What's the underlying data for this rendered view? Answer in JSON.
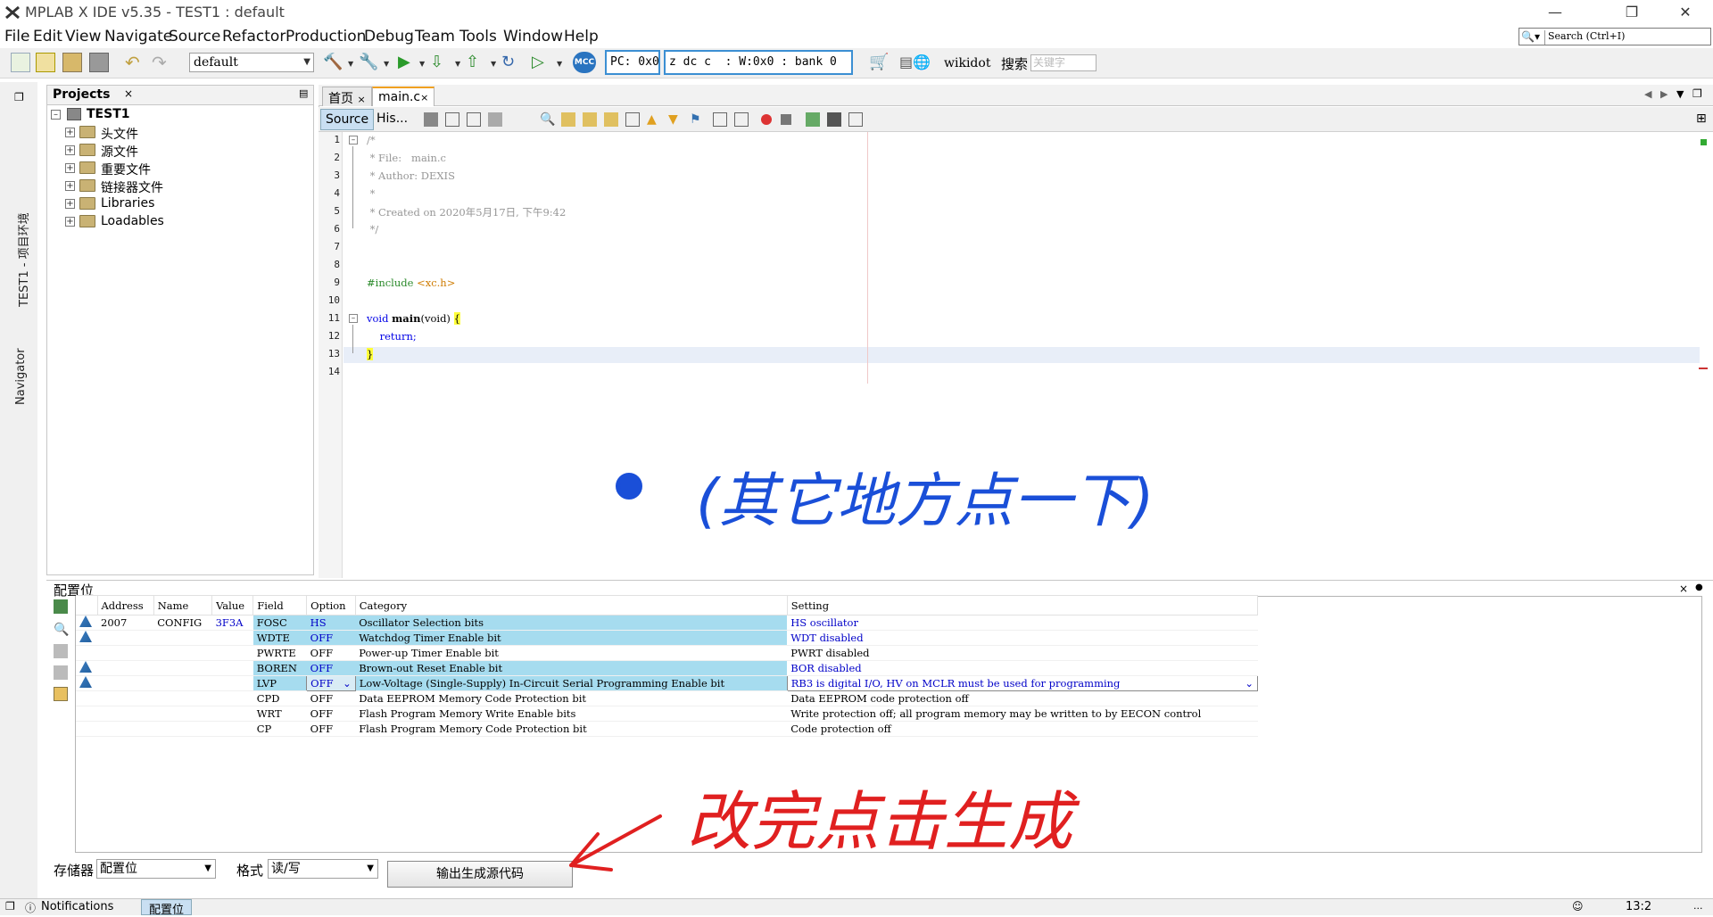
{
  "window": {
    "title": "MPLAB X IDE v5.35 - TEST1 : default",
    "controls": [
      "minimize-icon",
      "restore-icon",
      "close-icon"
    ]
  },
  "menu": [
    "File",
    "Edit",
    "View",
    "Navigate",
    "Source",
    "Refactor",
    "Production",
    "Debug",
    "Team",
    "Tools",
    "Window",
    "Help"
  ],
  "search": {
    "placeholder": "Search (Ctrl+I)"
  },
  "toolbar": {
    "config": "default",
    "pc": "PC: 0x0",
    "status_bits": "z dc c  : W:0x0 : bank 0",
    "wiki": "wikidot",
    "search_cn": "搜索",
    "keyword_placeholder": "关键字"
  },
  "left_strip": {
    "projects_env": "TEST1 - 项目环境",
    "navigator": "Navigator"
  },
  "projects": {
    "title": "Projects",
    "root": "TEST1",
    "items": [
      "头文件",
      "源文件",
      "重要文件",
      "链接器文件",
      "Libraries",
      "Loadables"
    ]
  },
  "editor": {
    "tabs": [
      {
        "label": "首页"
      },
      {
        "label": "main.c"
      }
    ],
    "view_tabs": [
      "Source",
      "His..."
    ],
    "lines": [
      {
        "n": "1",
        "t": "/*"
      },
      {
        "n": "2",
        "t": " * File:   main.c"
      },
      {
        "n": "3",
        "t": " * Author: DEXIS"
      },
      {
        "n": "4",
        "t": " *"
      },
      {
        "n": "5",
        "t": " * Created on 2020年5月17日, 下午9:42"
      },
      {
        "n": "6",
        "t": " */"
      },
      {
        "n": "7",
        "t": ""
      },
      {
        "n": "8",
        "t": ""
      },
      {
        "n": "9",
        "t": "#include "
      },
      {
        "n": "10",
        "t": ""
      },
      {
        "n": "11",
        "t": "void "
      },
      {
        "n": "12",
        "t": "    return;"
      },
      {
        "n": "13",
        "t": "}"
      },
      {
        "n": "14",
        "t": ""
      }
    ],
    "include_header": "<xc.h>",
    "main_name": "main",
    "main_args": "(void) ",
    "brace_open": "{"
  },
  "annotation_top": "(其它地方点一下)",
  "annotation_bottom": "改完点击生成",
  "config_bits": {
    "title": "配置位",
    "columns": [
      "Address",
      "Name",
      "Value",
      "Field",
      "Option",
      "Category",
      "Setting"
    ],
    "rows": [
      {
        "address": "2007",
        "name": "CONFIG",
        "value": "3F3A",
        "field": "FOSC",
        "option": "HS",
        "category": "Oscillator Selection bits",
        "setting": "HS oscillator",
        "hl": true,
        "warn": true
      },
      {
        "address": "",
        "name": "",
        "value": "",
        "field": "WDTE",
        "option": "OFF",
        "category": "Watchdog Timer Enable bit",
        "setting": "WDT disabled",
        "hl": true,
        "warn": true
      },
      {
        "address": "",
        "name": "",
        "value": "",
        "field": "PWRTE",
        "option": "OFF",
        "category": "Power-up Timer Enable bit",
        "setting": "PWRT disabled",
        "hl": false,
        "warn": false
      },
      {
        "address": "",
        "name": "",
        "value": "",
        "field": "BOREN",
        "option": "OFF",
        "category": "Brown-out Reset Enable bit",
        "setting": "BOR disabled",
        "hl": true,
        "warn": true
      },
      {
        "address": "",
        "name": "",
        "value": "",
        "field": "LVP",
        "option": "OFF",
        "category": "Low-Voltage (Single-Supply) In-Circuit Serial Programming Enable bit",
        "setting": "RB3 is digital I/O, HV on MCLR must be used for programming",
        "hl": true,
        "warn": true
      },
      {
        "address": "",
        "name": "",
        "value": "",
        "field": "CPD",
        "option": "OFF",
        "category": "Data EEPROM Memory Code Protection bit",
        "setting": "Data EEPROM code protection off",
        "hl": false,
        "warn": false
      },
      {
        "address": "",
        "name": "",
        "value": "",
        "field": "WRT",
        "option": "OFF",
        "category": "Flash Program Memory Write Enable bits",
        "setting": "Write protection off; all program memory may be written to by EECON control",
        "hl": false,
        "warn": false
      },
      {
        "address": "",
        "name": "",
        "value": "",
        "field": "CP",
        "option": "OFF",
        "category": "Flash Program Memory Code Protection bit",
        "setting": "Code protection off",
        "hl": false,
        "warn": false
      }
    ],
    "memory_label": "存储器",
    "memory_value": "配置位",
    "format_label": "格式",
    "format_value": "读/写",
    "generate_button": "输出生成源代码"
  },
  "status_bar": {
    "notifications": "Notifications",
    "config_tab": "配置位",
    "position": "13:2",
    "ins": "..."
  }
}
